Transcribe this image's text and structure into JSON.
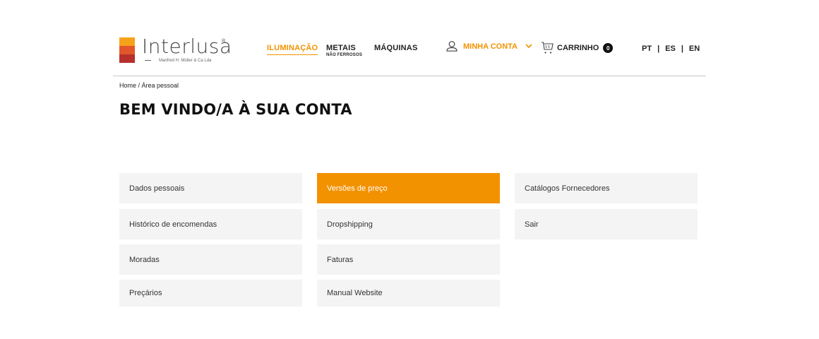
{
  "brand": {
    "name": "Interlusa",
    "reg": "®",
    "subtitle": "Manfred H. Müller & Ca Lda",
    "colors": {
      "accent": "#f39200",
      "logo_top": "#f7a21b",
      "logo_mid": "#e2572a",
      "logo_bottom": "#b8302c"
    }
  },
  "nav": {
    "iluminacao": "ILUMINAÇÃO",
    "metais": "METAIS",
    "metais_sub": "NÃO FERROSOS",
    "maquinas": "MÁQUINAS"
  },
  "account": {
    "label": "MINHA CONTA",
    "icon": "user-icon",
    "dropdown_icon": "chevron-down-icon"
  },
  "cart": {
    "label": "CARRINHO",
    "count": "0",
    "icon": "cart-icon"
  },
  "languages": {
    "pt": "PT",
    "es": "ES",
    "en": "EN",
    "separator": "|"
  },
  "breadcrumb": "Home / Área pessoal",
  "page_title": "BEM VINDO/A À SUA CONTA",
  "menu": {
    "col1": [
      "Dados pessoais",
      "Histórico de encomendas",
      "Moradas",
      "Preçários"
    ],
    "col2": [
      "Versões de preço",
      "Dropshipping",
      "Faturas",
      "Manual Website"
    ],
    "col3": [
      "Catálogos Fornecedores",
      "Sair"
    ],
    "active": "Versões de preço"
  }
}
